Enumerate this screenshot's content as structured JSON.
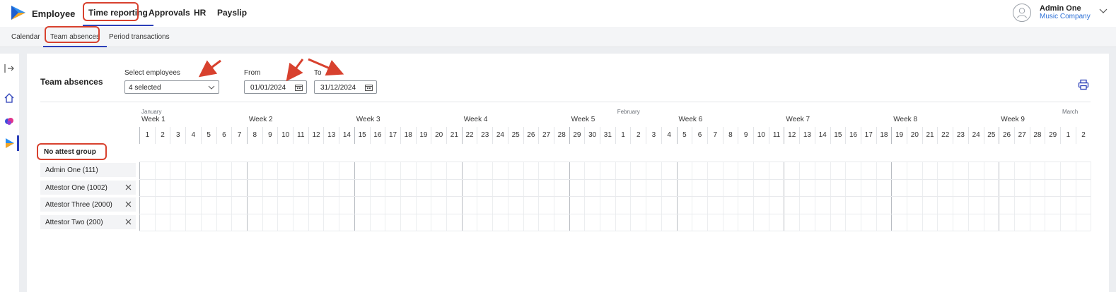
{
  "app": {
    "title": "Employee",
    "logo_icon": "play-logo-icon"
  },
  "nav": {
    "items": [
      {
        "label": "Time reporting",
        "active": true
      },
      {
        "label": "Approvals",
        "active": false
      },
      {
        "label": "HR",
        "active": false
      },
      {
        "label": "Payslip",
        "active": false
      }
    ]
  },
  "user": {
    "name": "Admin One",
    "company": "Music Company"
  },
  "subnav": {
    "items": [
      {
        "label": "Calendar",
        "active": false
      },
      {
        "label": "Team absences",
        "active": true
      },
      {
        "label": "Period transactions",
        "active": false
      }
    ]
  },
  "rail": {
    "icons": [
      "collapse-icon",
      "home-icon",
      "cloud-icon",
      "play-icon"
    ]
  },
  "page": {
    "title": "Team absences",
    "select_employees": {
      "label": "Select employees",
      "value": "4 selected"
    },
    "from": {
      "label": "From",
      "value": "01/01/2024"
    },
    "to": {
      "label": "To",
      "value": "31/12/2024"
    }
  },
  "timeline": {
    "months": [
      "January",
      "February",
      "March"
    ],
    "weeks": [
      "Week 1",
      "Week 2",
      "Week 3",
      "Week 4",
      "Week 5",
      "Week 6",
      "Week 7",
      "Week 8",
      "Week 9"
    ],
    "days": [
      "1",
      "2",
      "3",
      "4",
      "5",
      "6",
      "7",
      "8",
      "9",
      "10",
      "11",
      "12",
      "13",
      "14",
      "15",
      "16",
      "17",
      "18",
      "19",
      "20",
      "21",
      "22",
      "23",
      "24",
      "25",
      "26",
      "27",
      "28",
      "29",
      "30",
      "31",
      "1",
      "2",
      "3",
      "4",
      "5",
      "6",
      "7",
      "8",
      "9",
      "10",
      "11",
      "12",
      "13",
      "14",
      "15",
      "16",
      "17",
      "18",
      "19",
      "20",
      "21",
      "22",
      "23",
      "24",
      "25",
      "26",
      "27",
      "28",
      "29",
      "1",
      "2"
    ]
  },
  "group": {
    "title": "No attest group",
    "employees": [
      {
        "name": "Admin One (111)",
        "removable": false
      },
      {
        "name": "Attestor One (1002)",
        "removable": true
      },
      {
        "name": "Attestor Three (2000)",
        "removable": true
      },
      {
        "name": "Attestor Two (200)",
        "removable": true
      }
    ]
  },
  "colors": {
    "accent": "#2b3fb8",
    "annotation": "#d8412e",
    "company_link": "#2b6fd6"
  }
}
